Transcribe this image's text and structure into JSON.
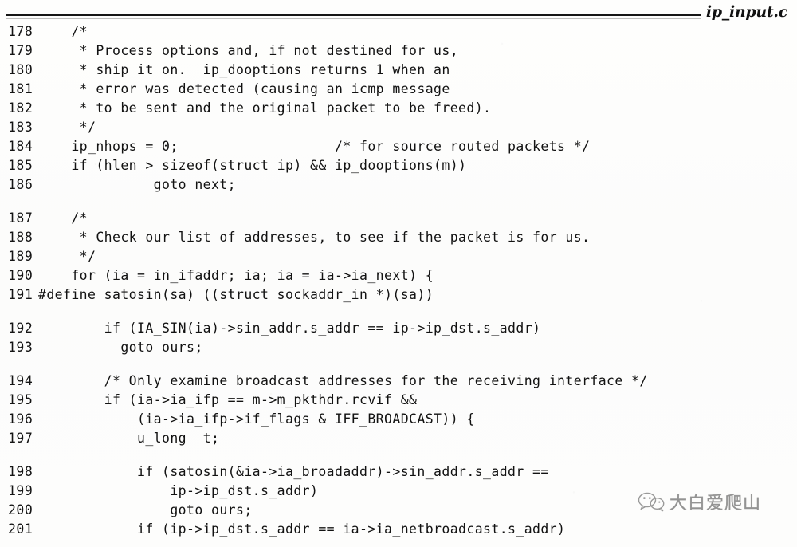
{
  "header": {
    "filename": "ip_input.c"
  },
  "watermark": {
    "text": "大白爱爬山",
    "icon": "wechat-icon"
  },
  "listing": {
    "lines": [
      {
        "number": "178",
        "code": "    /*",
        "gap_after": false
      },
      {
        "number": "179",
        "code": "     * Process options and, if not destined for us,",
        "gap_after": false
      },
      {
        "number": "180",
        "code": "     * ship it on.  ip_dooptions returns 1 when an",
        "gap_after": false
      },
      {
        "number": "181",
        "code": "     * error was detected (causing an icmp message",
        "gap_after": false
      },
      {
        "number": "182",
        "code": "     * to be sent and the original packet to be freed).",
        "gap_after": false
      },
      {
        "number": "183",
        "code": "     */",
        "gap_after": false
      },
      {
        "number": "184",
        "code": "    ip_nhops = 0;                   /* for source routed packets */",
        "gap_after": false
      },
      {
        "number": "185",
        "code": "    if (hlen > sizeof(struct ip) && ip_dooptions(m))",
        "gap_after": false
      },
      {
        "number": "186",
        "code": "              goto next;",
        "gap_after": true
      },
      {
        "number": "187",
        "code": "    /*",
        "gap_after": false
      },
      {
        "number": "188",
        "code": "     * Check our list of addresses, to see if the packet is for us.",
        "gap_after": false
      },
      {
        "number": "189",
        "code": "     */",
        "gap_after": false
      },
      {
        "number": "190",
        "code": "    for (ia = in_ifaddr; ia; ia = ia->ia_next) {",
        "gap_after": false
      },
      {
        "number": "191",
        "code": "#define satosin(sa) ((struct sockaddr_in *)(sa))",
        "gap_after": true
      },
      {
        "number": "192",
        "code": "        if (IA_SIN(ia)->sin_addr.s_addr == ip->ip_dst.s_addr)",
        "gap_after": false
      },
      {
        "number": "193",
        "code": "          goto ours;",
        "gap_after": true
      },
      {
        "number": "194",
        "code": "        /* Only examine broadcast addresses for the receiving interface */",
        "gap_after": false
      },
      {
        "number": "195",
        "code": "        if (ia->ia_ifp == m->m_pkthdr.rcvif &&",
        "gap_after": false
      },
      {
        "number": "196",
        "code": "            (ia->ia_ifp->if_flags & IFF_BROADCAST)) {",
        "gap_after": false
      },
      {
        "number": "197",
        "code": "            u_long  t;",
        "gap_after": true
      },
      {
        "number": "198",
        "code": "            if (satosin(&ia->ia_broadaddr)->sin_addr.s_addr ==",
        "gap_after": false
      },
      {
        "number": "199",
        "code": "                ip->ip_dst.s_addr)",
        "gap_after": false
      },
      {
        "number": "200",
        "code": "                goto ours;",
        "gap_after": false
      },
      {
        "number": "201",
        "code": "            if (ip->ip_dst.s_addr == ia->ia_netbroadcast.s_addr)",
        "gap_after": false
      }
    ]
  }
}
